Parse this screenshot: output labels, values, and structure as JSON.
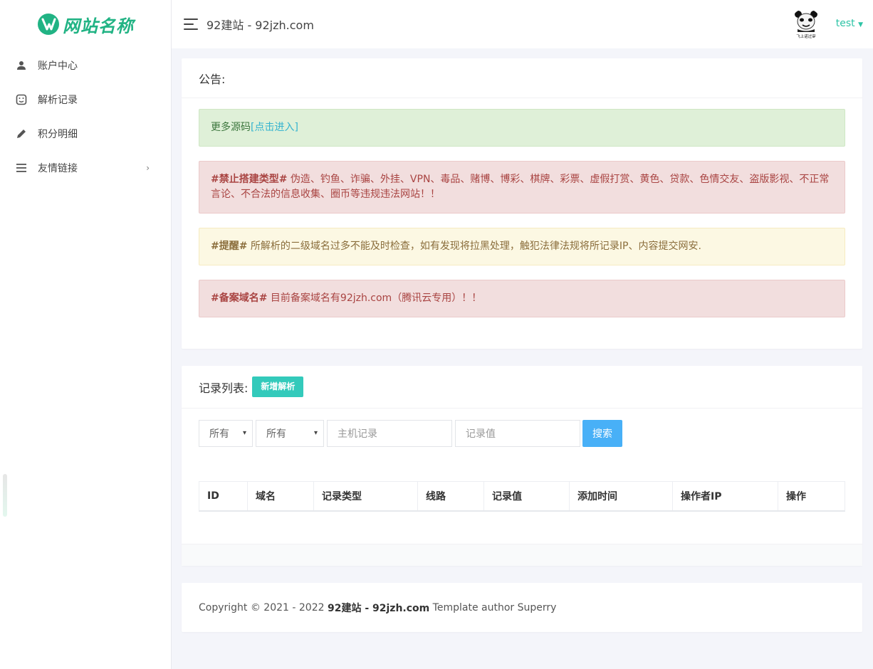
{
  "brand": {
    "logo_text": "网站名称",
    "accent": "#21b384"
  },
  "sidebar": {
    "items": [
      {
        "label": "账户中心",
        "icon": "user-icon"
      },
      {
        "label": "解析记录",
        "icon": "sticker-icon"
      },
      {
        "label": "积分明细",
        "icon": "pencil-icon"
      },
      {
        "label": "友情链接",
        "icon": "menu-lines-icon",
        "chevron": "›"
      }
    ]
  },
  "header": {
    "title": "92建站 - 92jzh.com",
    "user": "test",
    "avatar_caption": "飞上诺过审"
  },
  "notice": {
    "heading": "公告:",
    "alert1": {
      "text": "更多源码",
      "link": "[点击进入]"
    },
    "alert2": {
      "tag": "#禁止搭建类型#",
      "text": " 伪造、钓鱼、诈骗、外挂、VPN、毒品、赌博、博彩、棋牌、彩票、虚假打赏、黄色、贷款、色情交友、盗版影视、不正常言论、不合法的信息收集、圈币等违规违法网站！！"
    },
    "alert3": {
      "tag": "#提醒#",
      "text": " 所解析的二级域名过多不能及时检查，如有发现将拉黑处理，触犯法律法规将所记录IP、内容提交网安."
    },
    "alert4": {
      "tag": "#备案域名#",
      "text": " 目前备案域名有92jzh.com（腾讯云专用）！！"
    }
  },
  "records": {
    "heading": "记录列表:",
    "add_button": "新增解析",
    "filters": {
      "select1": "所有",
      "select2": "所有",
      "host_placeholder": "主机记录",
      "value_placeholder": "记录值"
    },
    "search_button": "搜索",
    "columns": [
      "ID",
      "域名",
      "记录类型",
      "线路",
      "记录值",
      "添加时间",
      "操作者IP",
      "操作"
    ]
  },
  "footer": {
    "prefix": "Copyright © 2021 - 2022 ",
    "bold": "92建站 - 92jzh.com",
    "suffix": " Template author Superry"
  },
  "colors": {
    "teal": "#33cabb",
    "blue": "#48b0f7",
    "user_link": "#2ec4a6"
  }
}
